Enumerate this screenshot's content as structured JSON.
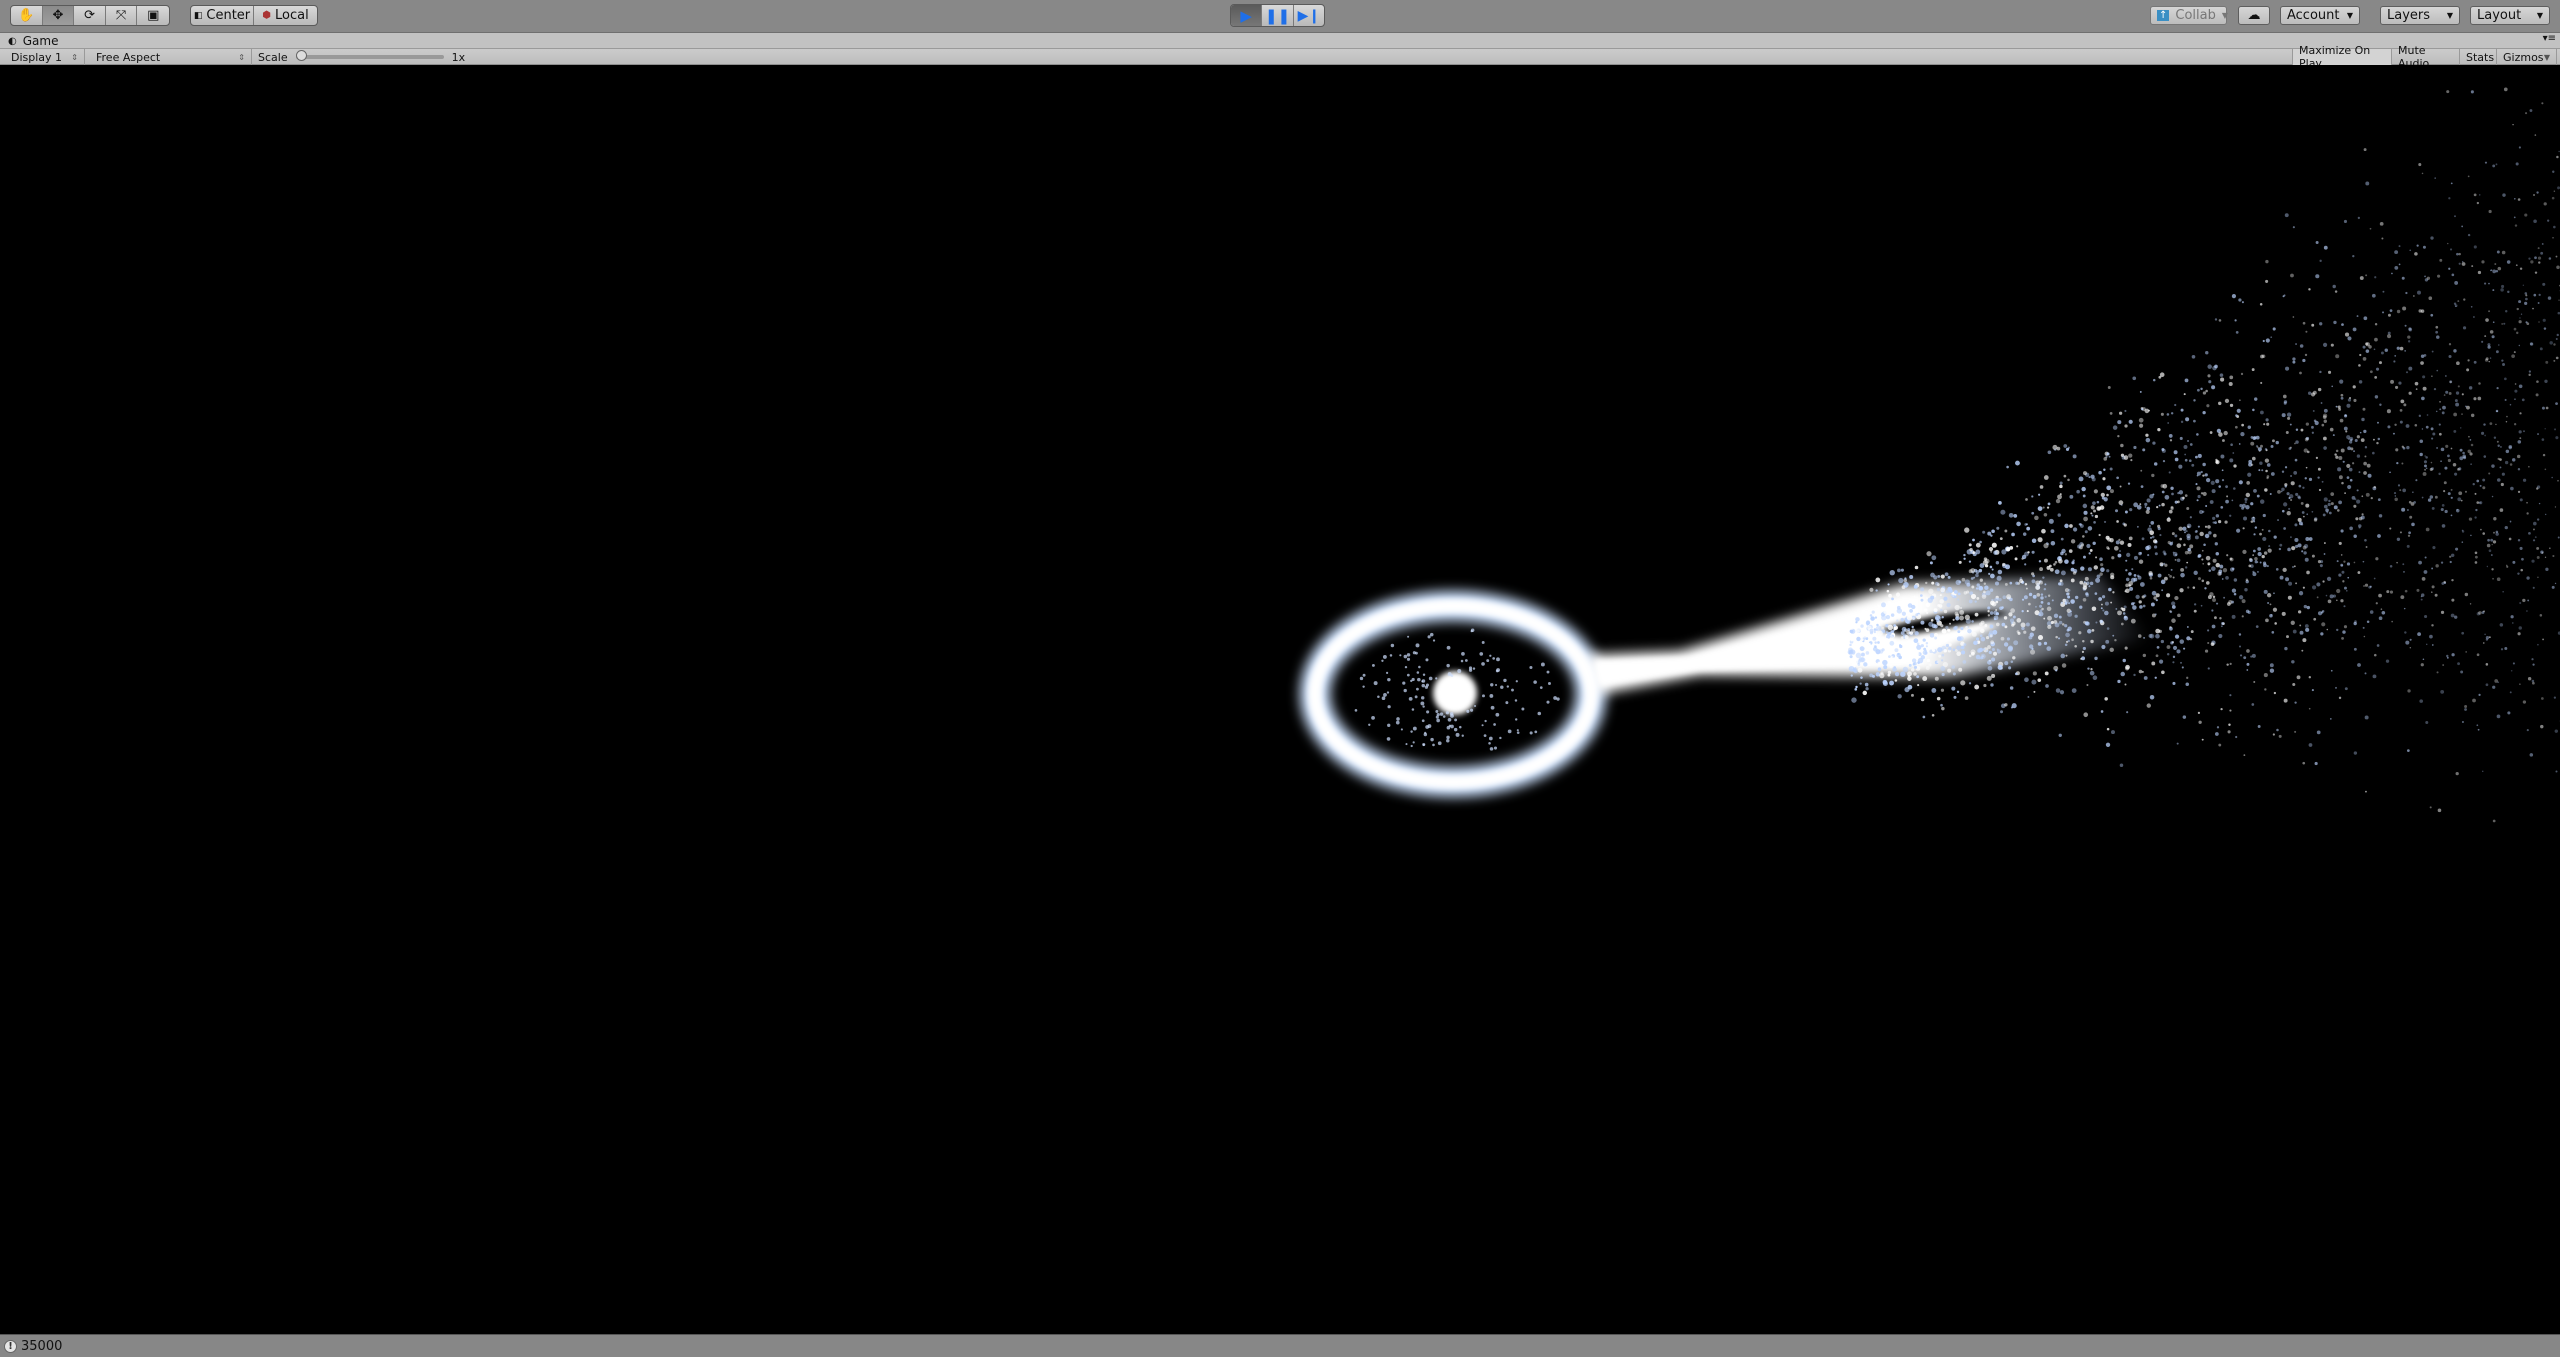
{
  "toolbar": {
    "tools": [
      "hand-tool",
      "move-tool",
      "rotate-tool",
      "scale-tool",
      "rect-tool"
    ],
    "active_tool": "move-tool",
    "pivot_label": "Center",
    "space_label": "Local",
    "collab_label": "Collab",
    "account_label": "Account",
    "layers_label": "Layers",
    "layout_label": "Layout",
    "play_color": "#1f6fe8"
  },
  "tab": {
    "label": "Game"
  },
  "game_toolbar": {
    "display": "Display 1",
    "aspect": "Free Aspect",
    "scale_label": "Scale",
    "scale_value": "1x",
    "scale_fraction": 0,
    "maximize": "Maximize On Play",
    "mute": "Mute Audio",
    "stats": "Stats",
    "gizmos": "Gizmos"
  },
  "status": {
    "message": "35000"
  }
}
